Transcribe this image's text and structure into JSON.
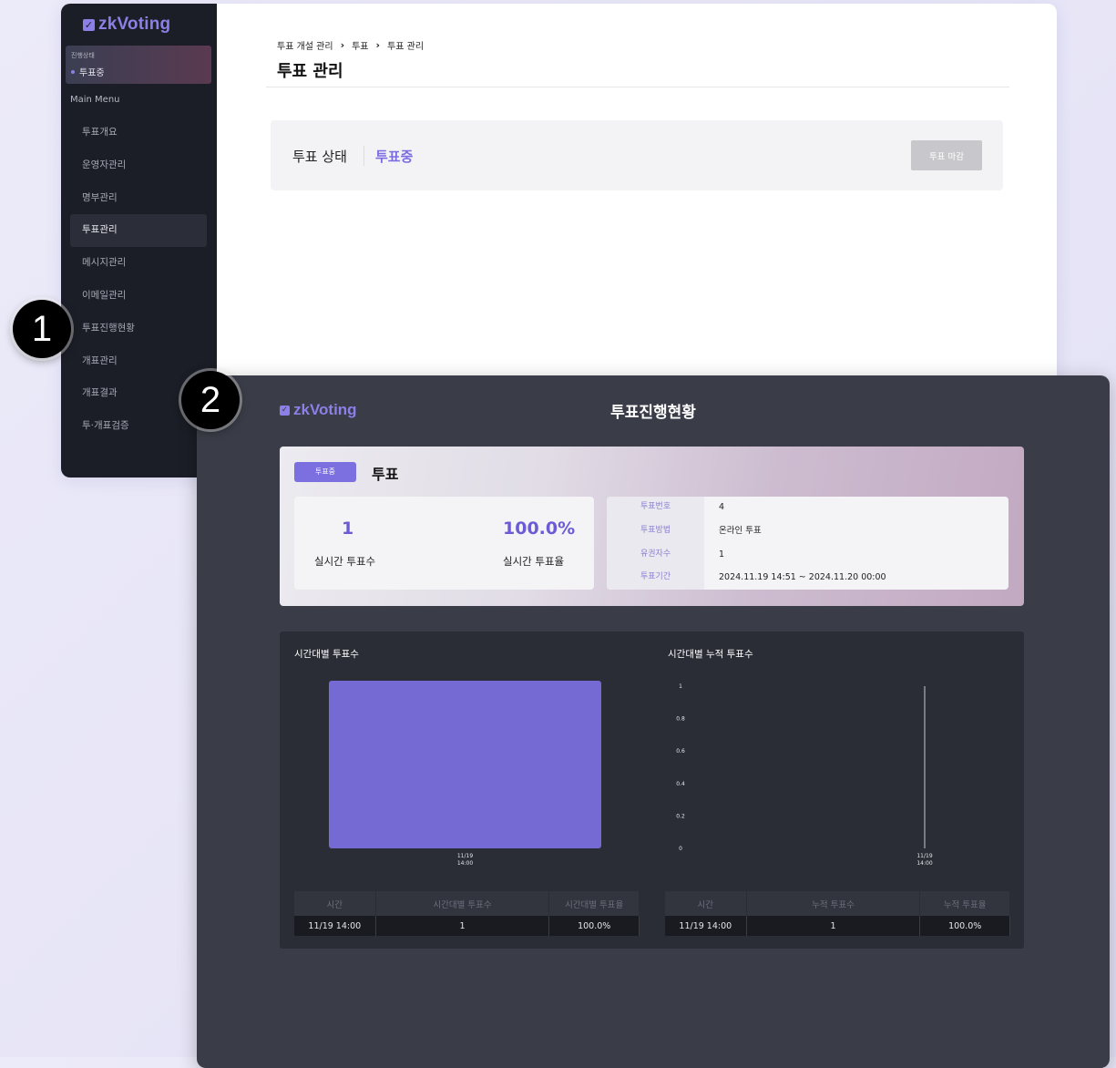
{
  "admin": {
    "logo": "zkVoting",
    "status_label": "진행상태",
    "status_value": "투표중",
    "menu_title": "Main Menu",
    "menu_items": [
      "투표개요",
      "운영자관리",
      "명부관리",
      "투표관리",
      "메시지관리",
      "이메일관리",
      "투표진행현황",
      "개표관리",
      "개표결과",
      "투·개표검증"
    ],
    "active_menu": "투표관리",
    "breadcrumb": [
      "투표 개설 관리",
      "투표",
      "투표 관리"
    ],
    "breadcrumb_sep": "›",
    "page_title": "투표 관리",
    "vote_status_label": "투표 상태",
    "vote_status_value": "투표중",
    "close_button": "투표 마감"
  },
  "badges": [
    "1",
    "2"
  ],
  "progress": {
    "logo": "zkVoting",
    "title": "투표진행현황",
    "summary": {
      "badge": "투표중",
      "title": "투표",
      "realtime_votes_value": "1",
      "realtime_votes_label": "실시간 투표수",
      "realtime_rate_value": "100.0%",
      "realtime_rate_label": "실시간 투표율",
      "info": [
        {
          "label": "투표번호",
          "value": "4"
        },
        {
          "label": "투표방법",
          "value": "온라인 투표"
        },
        {
          "label": "유권자수",
          "value": "1"
        },
        {
          "label": "투표기간",
          "value": "2024.11.19 14:51 ~ 2024.11.20 00:00"
        }
      ]
    },
    "chart1_title": "시간대별 투표수",
    "chart2_title": "시간대별 누적 투표수",
    "table1": {
      "headers": [
        "시간",
        "시간대별 투표수",
        "시간대별 투표율"
      ],
      "rows": [
        [
          "11/19 14:00",
          "1",
          "100.0%"
        ]
      ]
    },
    "table2": {
      "headers": [
        "시간",
        "누적 투표수",
        "누적 투표율"
      ],
      "rows": [
        [
          "11/19 14:00",
          "1",
          "100.0%"
        ]
      ]
    }
  },
  "colors": {
    "accent": "#7c6fe0",
    "bar": "#756ad4",
    "sidebar": "#1c1e27",
    "panel": "#3a3d47"
  },
  "chart_data": [
    {
      "type": "bar",
      "title": "시간대별 투표수",
      "categories": [
        "11/19\n14:00"
      ],
      "values": [
        1
      ],
      "ylim": [
        0,
        1
      ]
    },
    {
      "type": "line",
      "title": "시간대별 누적 투표수",
      "x": [
        "11/19\n14:00"
      ],
      "values": [
        1
      ],
      "yticks": [
        "1",
        "0.8",
        "0.6",
        "0.4",
        "0.2",
        "0"
      ],
      "ylim": [
        0,
        1
      ]
    }
  ]
}
